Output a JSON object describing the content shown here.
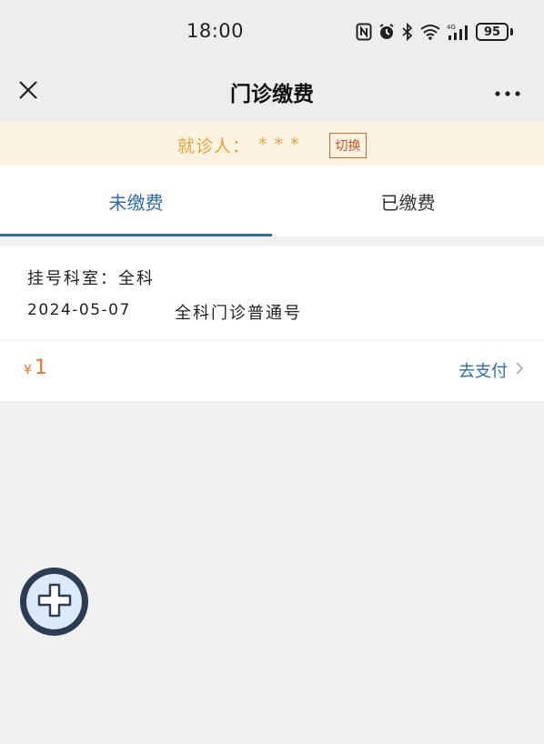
{
  "status_bar": {
    "time": "18:00",
    "battery": "95",
    "icons": [
      "nfc-icon",
      "alarm-icon",
      "bluetooth-icon",
      "wifi-icon",
      "signal-icon",
      "battery-icon"
    ]
  },
  "nav": {
    "title": "门诊缴费",
    "close_icon": "close-icon",
    "more_icon": "more-icon"
  },
  "patient": {
    "label": "就诊人：",
    "name": "***",
    "switch_label": "切换"
  },
  "tabs": [
    {
      "label": "未缴费",
      "active": true
    },
    {
      "label": "已缴费",
      "active": false
    }
  ],
  "bill": {
    "department_line": "挂号科室：全科",
    "date": "2024-05-07",
    "type": "全科门诊普通号",
    "currency": "¥",
    "amount": "1",
    "pay_label": "去支付"
  },
  "colors": {
    "accent": "#2f6ca8",
    "banner_bg": "#fcf2e0",
    "banner_text": "#e3a53d",
    "amount": "#e07b2c",
    "fab": "#2b3d52"
  }
}
